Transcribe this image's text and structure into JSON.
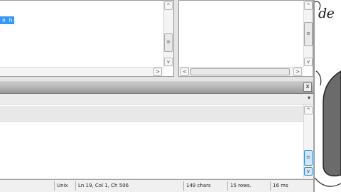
{
  "editor": {
    "selected_text": "n h"
  },
  "scrollbars": {
    "grip_glyph": "≡",
    "up": "^",
    "down": "v",
    "left": "<",
    "right": ">"
  },
  "results_toolbar": {
    "close_glyph": "x",
    "dropdown_glyph": "▾"
  },
  "drawing": {
    "text": "de"
  },
  "status_bar": {
    "line_ending": "Unix",
    "position": "Ln 19, Col 1, Ch 506",
    "chars": "149 chars",
    "rows": "15 rows.",
    "time": "16 ms"
  }
}
